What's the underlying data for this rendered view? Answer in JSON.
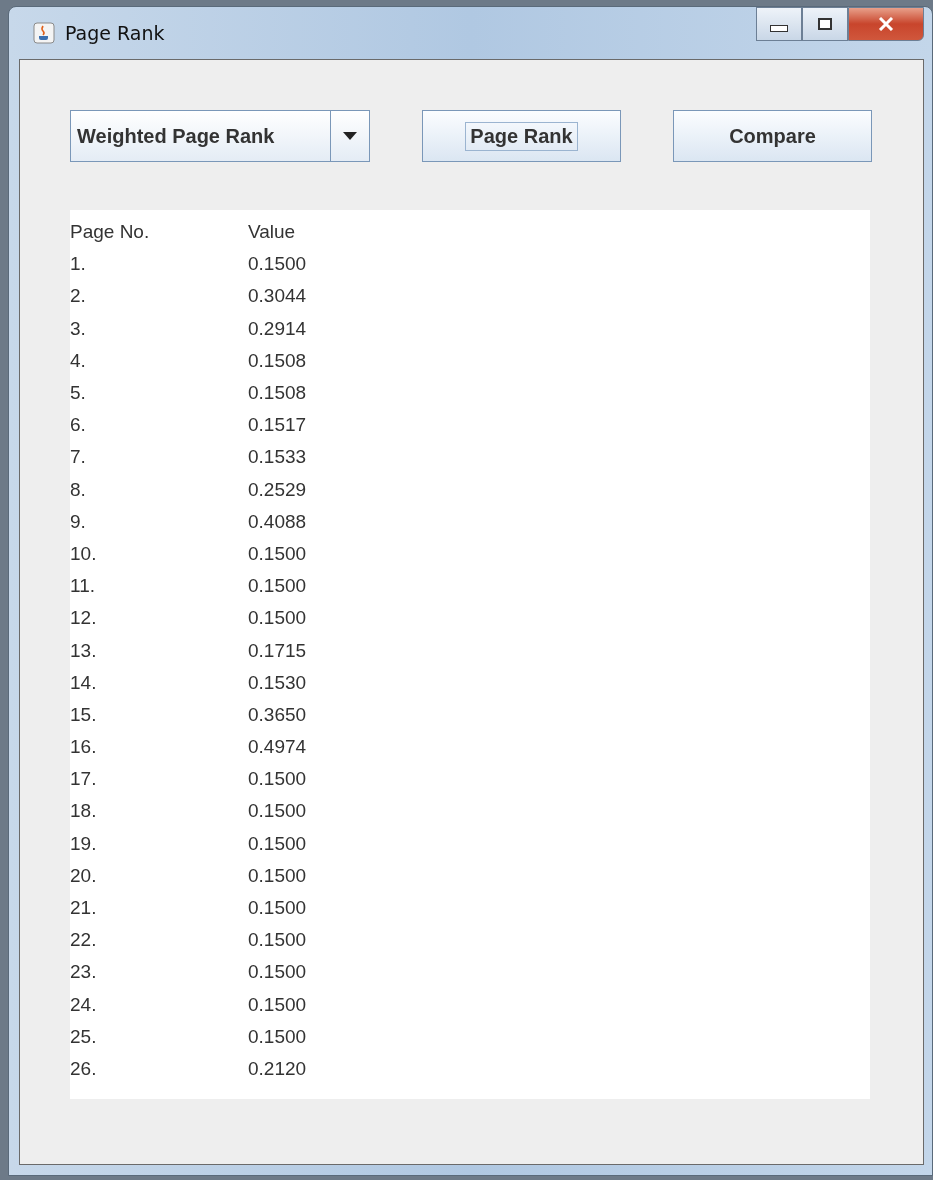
{
  "window": {
    "title": "Page Rank"
  },
  "algorithm_select": {
    "value": "Weighted Page Rank"
  },
  "buttons": [
    {
      "label": "Page Rank",
      "focused": true
    },
    {
      "label": "Compare",
      "focused": false
    }
  ],
  "output": {
    "columns": [
      "Page No.",
      "Value"
    ],
    "rows": [
      [
        "1.",
        "0.1500"
      ],
      [
        "2.",
        "0.3044"
      ],
      [
        "3.",
        "0.2914"
      ],
      [
        "4.",
        "0.1508"
      ],
      [
        "5.",
        "0.1508"
      ],
      [
        "6.",
        "0.1517"
      ],
      [
        "7.",
        "0.1533"
      ],
      [
        "8.",
        "0.2529"
      ],
      [
        "9.",
        "0.4088"
      ],
      [
        "10.",
        "0.1500"
      ],
      [
        "11.",
        "0.1500"
      ],
      [
        "12.",
        "0.1500"
      ],
      [
        "13.",
        "0.1715"
      ],
      [
        "14.",
        "0.1530"
      ],
      [
        "15.",
        "0.3650"
      ],
      [
        "16.",
        "0.4974"
      ],
      [
        "17.",
        "0.1500"
      ],
      [
        "18.",
        "0.1500"
      ],
      [
        "19.",
        "0.1500"
      ],
      [
        "20.",
        "0.1500"
      ],
      [
        "21.",
        "0.1500"
      ],
      [
        "22.",
        "0.1500"
      ],
      [
        "23.",
        "0.1500"
      ],
      [
        "24.",
        "0.1500"
      ],
      [
        "25.",
        "0.1500"
      ],
      [
        "26.",
        "0.2120"
      ]
    ]
  }
}
